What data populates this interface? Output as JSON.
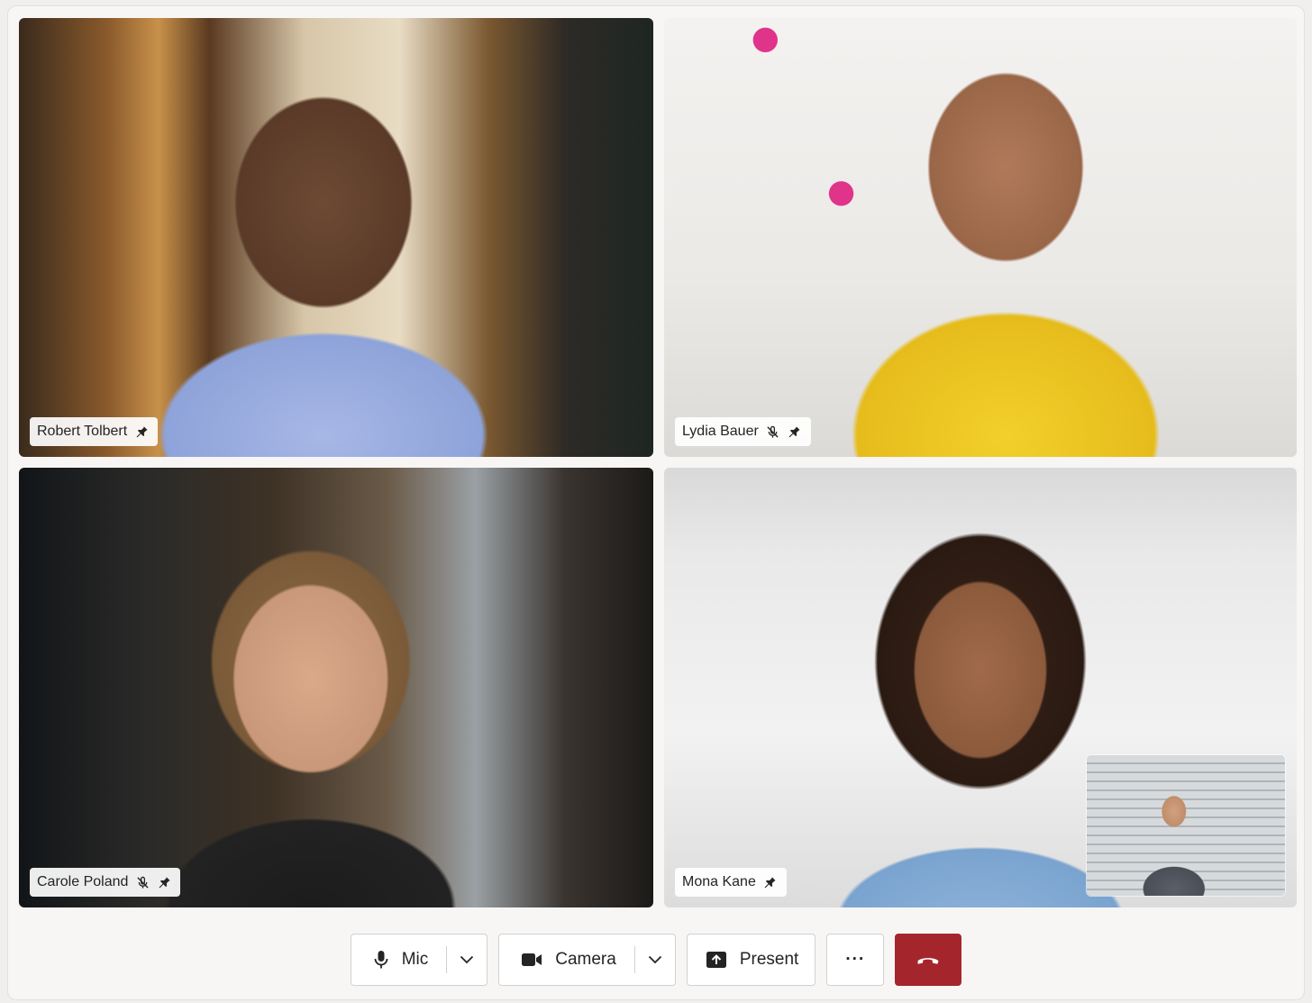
{
  "participants": [
    {
      "name": "Robert Tolbert",
      "muted": false,
      "pinned": true
    },
    {
      "name": "Lydia Bauer",
      "muted": true,
      "pinned": true
    },
    {
      "name": "Carole Poland",
      "muted": true,
      "pinned": true
    },
    {
      "name": "Mona Kane",
      "muted": false,
      "pinned": true
    }
  ],
  "controls": {
    "mic_label": "Mic",
    "camera_label": "Camera",
    "present_label": "Present",
    "more_label": "···"
  },
  "colors": {
    "leave_button": "#a4262c",
    "tag_background": "#ffffff",
    "text": "#242424"
  },
  "icons": {
    "pin": "pin-icon",
    "mic_off": "mic-off-icon",
    "mic": "mic-icon",
    "camera": "camera-icon",
    "present": "share-screen-icon",
    "chevron": "chevron-down-icon",
    "leave": "phone-hangup-icon"
  }
}
